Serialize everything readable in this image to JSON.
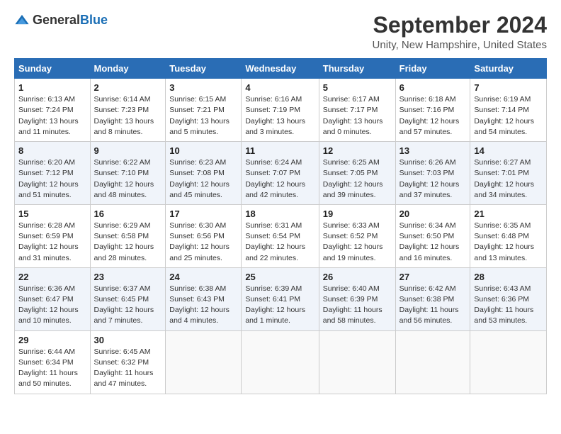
{
  "logo": {
    "text_general": "General",
    "text_blue": "Blue",
    "tagline": "GeneralBlue"
  },
  "header": {
    "month": "September 2024",
    "location": "Unity, New Hampshire, United States"
  },
  "days_of_week": [
    "Sunday",
    "Monday",
    "Tuesday",
    "Wednesday",
    "Thursday",
    "Friday",
    "Saturday"
  ],
  "weeks": [
    [
      {
        "day": "1",
        "sunrise": "6:13 AM",
        "sunset": "7:24 PM",
        "daylight": "13 hours and 11 minutes."
      },
      {
        "day": "2",
        "sunrise": "6:14 AM",
        "sunset": "7:23 PM",
        "daylight": "13 hours and 8 minutes."
      },
      {
        "day": "3",
        "sunrise": "6:15 AM",
        "sunset": "7:21 PM",
        "daylight": "13 hours and 5 minutes."
      },
      {
        "day": "4",
        "sunrise": "6:16 AM",
        "sunset": "7:19 PM",
        "daylight": "13 hours and 3 minutes."
      },
      {
        "day": "5",
        "sunrise": "6:17 AM",
        "sunset": "7:17 PM",
        "daylight": "13 hours and 0 minutes."
      },
      {
        "day": "6",
        "sunrise": "6:18 AM",
        "sunset": "7:16 PM",
        "daylight": "12 hours and 57 minutes."
      },
      {
        "day": "7",
        "sunrise": "6:19 AM",
        "sunset": "7:14 PM",
        "daylight": "12 hours and 54 minutes."
      }
    ],
    [
      {
        "day": "8",
        "sunrise": "6:20 AM",
        "sunset": "7:12 PM",
        "daylight": "12 hours and 51 minutes."
      },
      {
        "day": "9",
        "sunrise": "6:22 AM",
        "sunset": "7:10 PM",
        "daylight": "12 hours and 48 minutes."
      },
      {
        "day": "10",
        "sunrise": "6:23 AM",
        "sunset": "7:08 PM",
        "daylight": "12 hours and 45 minutes."
      },
      {
        "day": "11",
        "sunrise": "6:24 AM",
        "sunset": "7:07 PM",
        "daylight": "12 hours and 42 minutes."
      },
      {
        "day": "12",
        "sunrise": "6:25 AM",
        "sunset": "7:05 PM",
        "daylight": "12 hours and 39 minutes."
      },
      {
        "day": "13",
        "sunrise": "6:26 AM",
        "sunset": "7:03 PM",
        "daylight": "12 hours and 37 minutes."
      },
      {
        "day": "14",
        "sunrise": "6:27 AM",
        "sunset": "7:01 PM",
        "daylight": "12 hours and 34 minutes."
      }
    ],
    [
      {
        "day": "15",
        "sunrise": "6:28 AM",
        "sunset": "6:59 PM",
        "daylight": "12 hours and 31 minutes."
      },
      {
        "day": "16",
        "sunrise": "6:29 AM",
        "sunset": "6:58 PM",
        "daylight": "12 hours and 28 minutes."
      },
      {
        "day": "17",
        "sunrise": "6:30 AM",
        "sunset": "6:56 PM",
        "daylight": "12 hours and 25 minutes."
      },
      {
        "day": "18",
        "sunrise": "6:31 AM",
        "sunset": "6:54 PM",
        "daylight": "12 hours and 22 minutes."
      },
      {
        "day": "19",
        "sunrise": "6:33 AM",
        "sunset": "6:52 PM",
        "daylight": "12 hours and 19 minutes."
      },
      {
        "day": "20",
        "sunrise": "6:34 AM",
        "sunset": "6:50 PM",
        "daylight": "12 hours and 16 minutes."
      },
      {
        "day": "21",
        "sunrise": "6:35 AM",
        "sunset": "6:48 PM",
        "daylight": "12 hours and 13 minutes."
      }
    ],
    [
      {
        "day": "22",
        "sunrise": "6:36 AM",
        "sunset": "6:47 PM",
        "daylight": "12 hours and 10 minutes."
      },
      {
        "day": "23",
        "sunrise": "6:37 AM",
        "sunset": "6:45 PM",
        "daylight": "12 hours and 7 minutes."
      },
      {
        "day": "24",
        "sunrise": "6:38 AM",
        "sunset": "6:43 PM",
        "daylight": "12 hours and 4 minutes."
      },
      {
        "day": "25",
        "sunrise": "6:39 AM",
        "sunset": "6:41 PM",
        "daylight": "12 hours and 1 minute."
      },
      {
        "day": "26",
        "sunrise": "6:40 AM",
        "sunset": "6:39 PM",
        "daylight": "11 hours and 58 minutes."
      },
      {
        "day": "27",
        "sunrise": "6:42 AM",
        "sunset": "6:38 PM",
        "daylight": "11 hours and 56 minutes."
      },
      {
        "day": "28",
        "sunrise": "6:43 AM",
        "sunset": "6:36 PM",
        "daylight": "11 hours and 53 minutes."
      }
    ],
    [
      {
        "day": "29",
        "sunrise": "6:44 AM",
        "sunset": "6:34 PM",
        "daylight": "11 hours and 50 minutes."
      },
      {
        "day": "30",
        "sunrise": "6:45 AM",
        "sunset": "6:32 PM",
        "daylight": "11 hours and 47 minutes."
      },
      null,
      null,
      null,
      null,
      null
    ]
  ]
}
